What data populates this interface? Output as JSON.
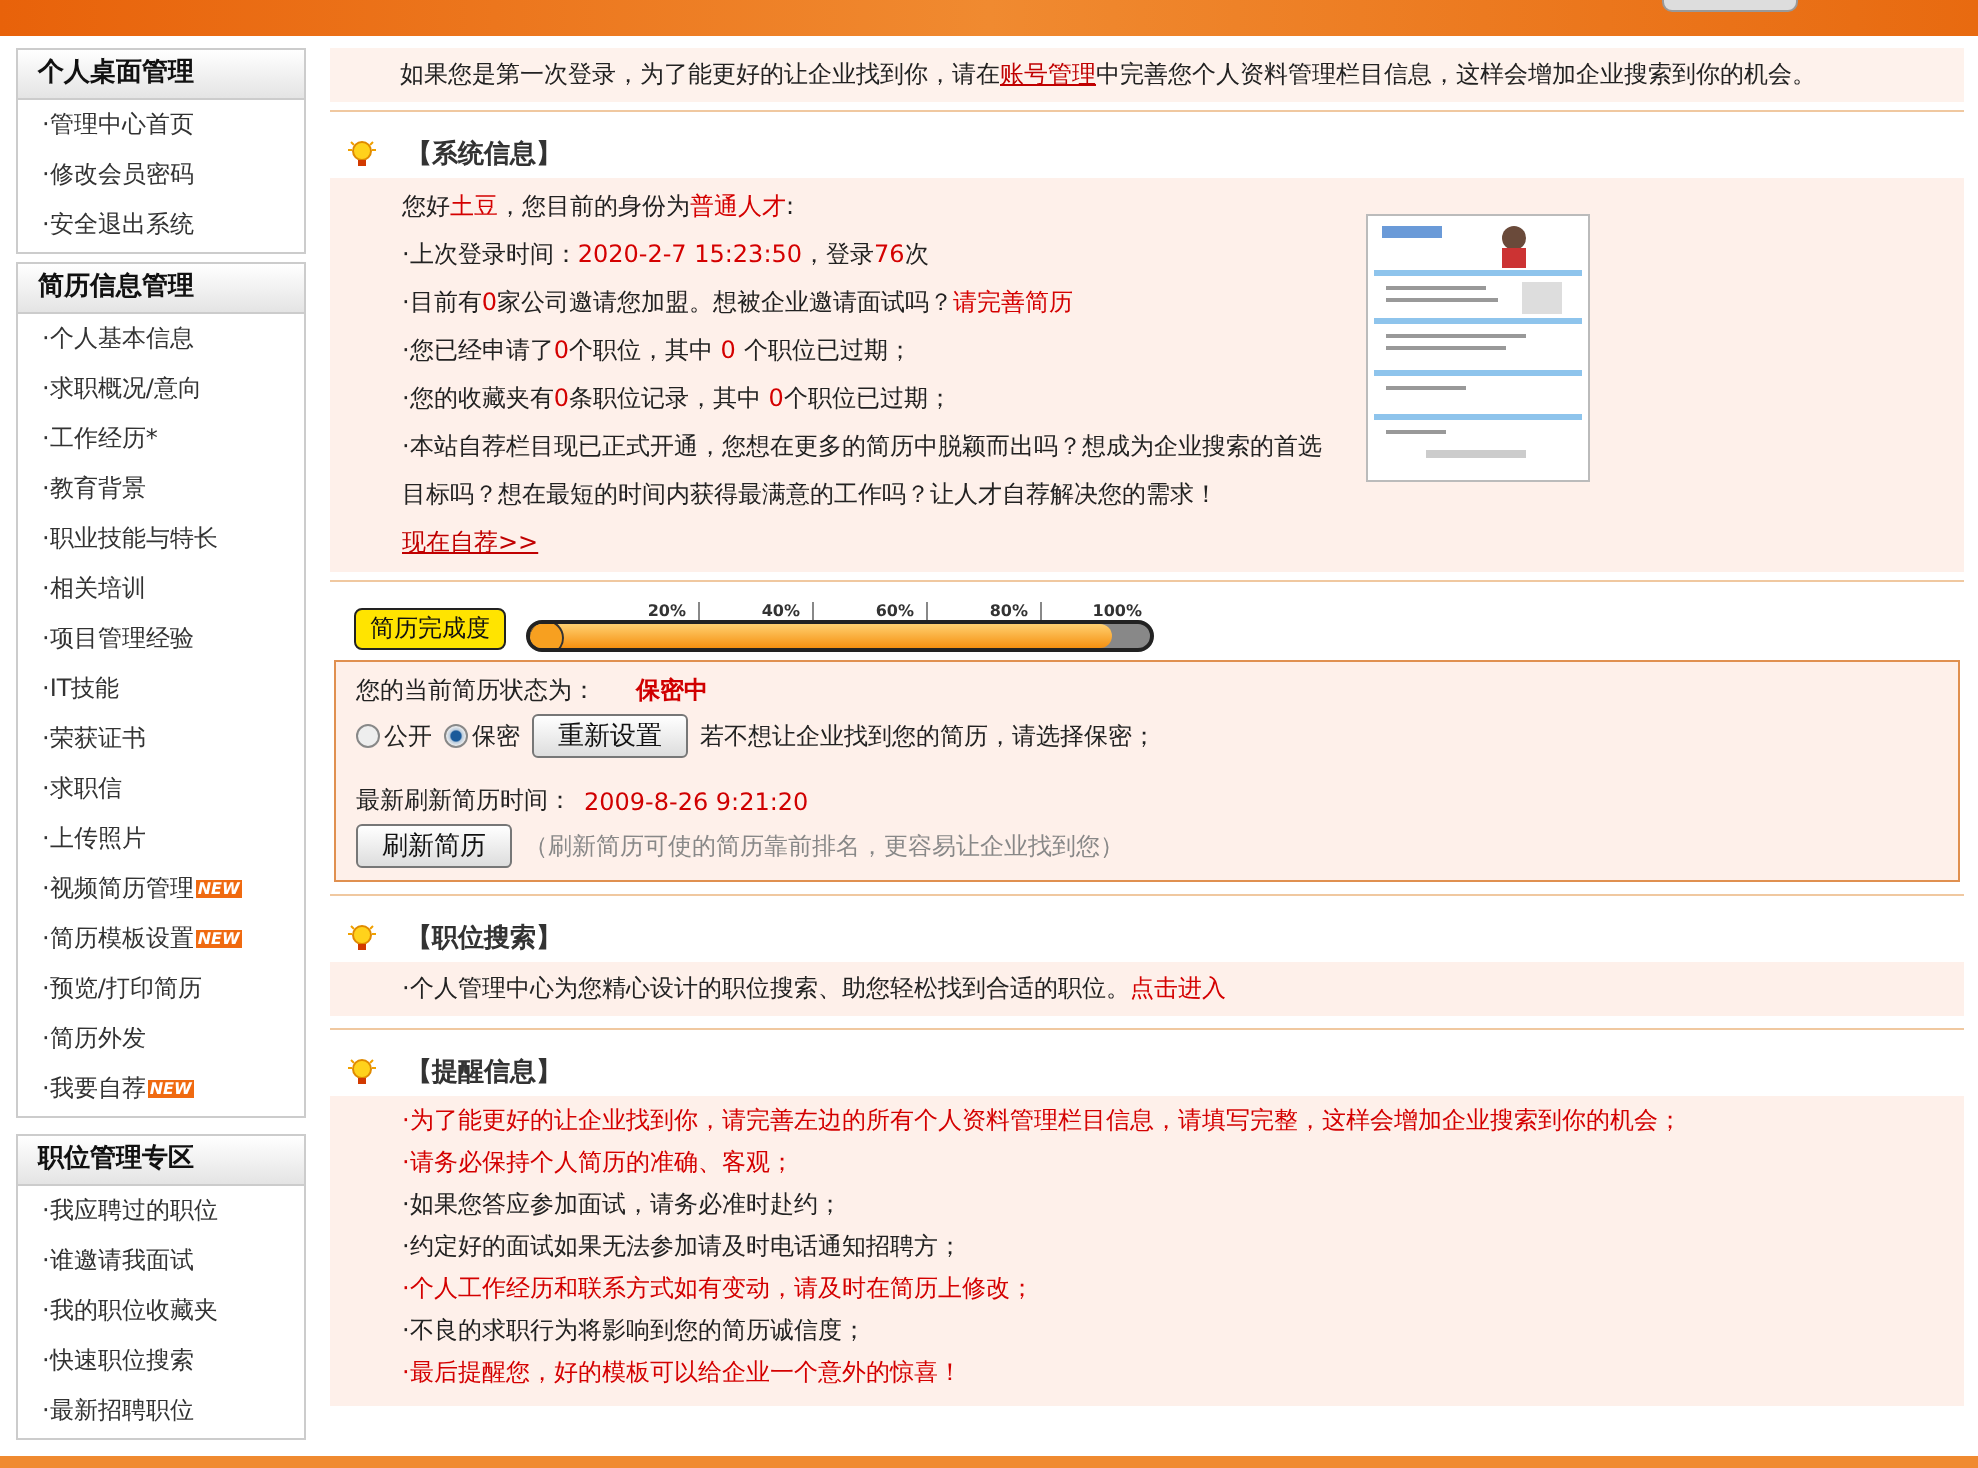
{
  "sidebar": [
    {
      "title": "个人桌面管理",
      "items": [
        {
          "label": "·管理中心首页"
        },
        {
          "label": "·修改会员密码"
        },
        {
          "label": "·安全退出系统"
        }
      ]
    },
    {
      "title": "简历信息管理",
      "items": [
        {
          "label": "·个人基本信息"
        },
        {
          "label": "·求职概况/意向"
        },
        {
          "label": "·工作经历*"
        },
        {
          "label": "·教育背景"
        },
        {
          "label": "·职业技能与特长"
        },
        {
          "label": "·相关培训"
        },
        {
          "label": "·项目管理经验"
        },
        {
          "label": "·IT技能"
        },
        {
          "label": "·荣获证书"
        },
        {
          "label": "·求职信"
        },
        {
          "label": "·上传照片"
        },
        {
          "label": "·视频简历管理",
          "badge": "NEW"
        },
        {
          "label": "·简历模板设置",
          "badge": "NEW"
        },
        {
          "label": "·预览/打印简历"
        },
        {
          "label": "·简历外发"
        },
        {
          "label": "·我要自荐",
          "badge": "NEW"
        }
      ]
    },
    {
      "title": "职位管理专区",
      "items": [
        {
          "label": "·我应聘过的职位"
        },
        {
          "label": "·谁邀请我面试"
        },
        {
          "label": "·我的职位收藏夹"
        },
        {
          "label": "·快速职位搜索"
        },
        {
          "label": "·最新招聘职位"
        }
      ]
    }
  ],
  "notice": [
    {
      "kind": "text",
      "text": "如果您是第一次登录，为了能更好的让企业找到你，请在"
    },
    {
      "kind": "link",
      "text": "账号管理"
    },
    {
      "kind": "text",
      "text": "中完善您个人资料管理栏目信息，这样会增加企业搜索到你的机会。"
    }
  ],
  "system_info": {
    "title": "【系统信息】",
    "lines": [
      [
        {
          "kind": "text",
          "text": "您好"
        },
        {
          "kind": "red",
          "text": "土豆"
        },
        {
          "kind": "text",
          "text": "，您目前的身份为"
        },
        {
          "kind": "red",
          "text": "普通人才"
        },
        {
          "kind": "text",
          "text": ":"
        }
      ],
      [
        {
          "kind": "text",
          "text": "·上次登录时间："
        },
        {
          "kind": "red",
          "text": "2020-2-7 15:23:50"
        },
        {
          "kind": "text",
          "text": "，登录"
        },
        {
          "kind": "red",
          "text": "76"
        },
        {
          "kind": "text",
          "text": "次"
        }
      ],
      [
        {
          "kind": "text",
          "text": "·目前有"
        },
        {
          "kind": "red",
          "text": "0"
        },
        {
          "kind": "text",
          "text": "家公司邀请您加盟。想被企业邀请面试吗？"
        },
        {
          "kind": "redlink",
          "text": "请完善简历"
        }
      ],
      [
        {
          "kind": "text",
          "text": "·您已经申请了"
        },
        {
          "kind": "red",
          "text": "0"
        },
        {
          "kind": "text",
          "text": "个职位，其中 "
        },
        {
          "kind": "red",
          "text": "0"
        },
        {
          "kind": "text",
          "text": " 个职位已过期；"
        }
      ],
      [
        {
          "kind": "text",
          "text": "·您的收藏夹有"
        },
        {
          "kind": "red",
          "text": "0"
        },
        {
          "kind": "text",
          "text": "条职位记录，其中 "
        },
        {
          "kind": "red",
          "text": "0"
        },
        {
          "kind": "text",
          "text": "个职位已过期；"
        }
      ],
      [
        {
          "kind": "text",
          "text": "·本站自荐栏目现已正式开通，您想在更多的简历中脱颖而出吗？想成为企业搜索的首选目标吗？想在最短的时间内获得最满意的工作吗？让人才自荐解决您的需求！ "
        },
        {
          "kind": "link",
          "text": "现在自荐>>"
        }
      ]
    ]
  },
  "completeness": {
    "label": "简历完成度",
    "ticks": [
      "20%",
      "40%",
      "60%",
      "80%",
      "100%"
    ],
    "level": 0.94
  },
  "status": {
    "label": "您的当前简历状态为：",
    "value": "保密中",
    "options": [
      {
        "label": "公开",
        "selected": false
      },
      {
        "label": "保密",
        "selected": true
      }
    ],
    "reset_button": "重新设置",
    "hint": "若不想让企业找到您的简历，请选择保密；",
    "refresh_label": "最新刷新简历时间：",
    "refresh_time": "2009-8-26 9:21:20",
    "refresh_button": "刷新简历",
    "refresh_hint": "（刷新简历可使的简历靠前排名，更容易让企业找到您）"
  },
  "job_search": {
    "title": "【职位搜索】",
    "lines": [
      [
        {
          "kind": "text",
          "text": "·个人管理中心为您精心设计的职位搜索、助您轻松找到合适的职位。"
        },
        {
          "kind": "redlink",
          "text": "点击进入"
        }
      ]
    ]
  },
  "reminders": {
    "title": "【提醒信息】",
    "items": [
      {
        "text": "·为了能更好的让企业找到你，请完善左边的所有个人资料管理栏目信息，请填写完整，这样会增加企业搜索到你的机会；",
        "highlight": true
      },
      {
        "text": "·请务必保持个人简历的准确、客观；",
        "highlight": true
      },
      {
        "text": "·如果您答应参加面试，请务必准时赴约；",
        "highlight": false
      },
      {
        "text": "·约定好的面试如果无法参加请及时电话通知招聘方；",
        "highlight": false
      },
      {
        "text": "·个人工作经历和联系方式如有变动，请及时在简历上修改；",
        "highlight": true
      },
      {
        "text": "·不良的求职行为将影响到您的简历诚信度；",
        "highlight": false
      },
      {
        "text": "·最后提醒您，好的模板可以给企业一个意外的惊喜！",
        "highlight": true
      }
    ]
  }
}
